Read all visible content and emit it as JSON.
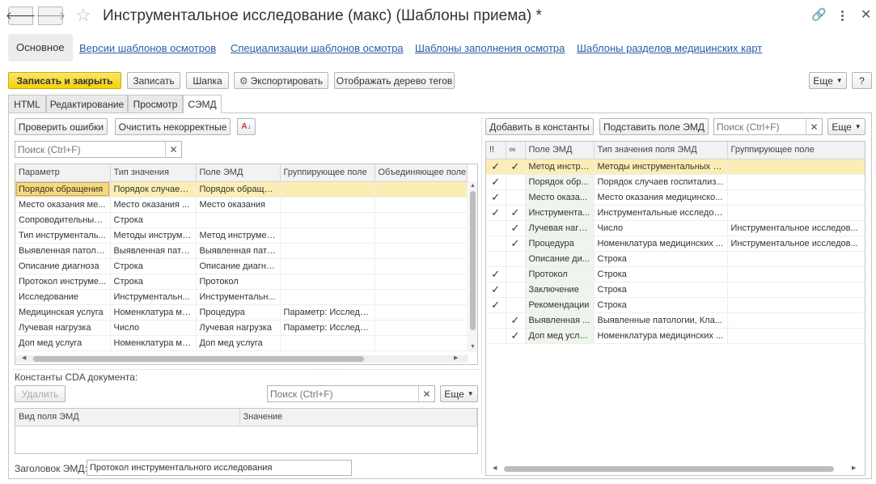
{
  "window": {
    "title": "Инструментальное исследование (макс) (Шаблоны приема) *"
  },
  "nav_tabs": [
    {
      "label": "Основное"
    },
    {
      "label": "Версии шаблонов осмотров"
    },
    {
      "label": "Специализации шаблонов осмотра"
    },
    {
      "label": "Шаблоны заполнения осмотра"
    },
    {
      "label": "Шаблоны разделов медицинских карт"
    }
  ],
  "toolbar": {
    "save_close": "Записать и закрыть",
    "save": "Записать",
    "header": "Шапка",
    "export": "Экспортировать",
    "tags_tree": "Отображать дерево тегов",
    "more": "Еще",
    "help": "?"
  },
  "inner_tabs": [
    {
      "label": "HTML"
    },
    {
      "label": "Редактирование"
    },
    {
      "label": "Просмотр"
    },
    {
      "label": "СЭМД"
    }
  ],
  "left": {
    "check_errors": "Проверить ошибки",
    "clear_incorrect": "Очистить некорректные",
    "search_placeholder": "Поиск (Ctrl+F)",
    "columns": [
      "Параметр",
      "Тип значения",
      "Поле ЭМД",
      "Группирующее поле",
      "Объединяющее поле"
    ],
    "rows": [
      [
        "Порядок обращения",
        "Порядок случаев ...",
        "Порядок обраще...",
        "",
        ""
      ],
      [
        "Место оказания ме...",
        "Место оказания ...",
        "Место оказания",
        "",
        ""
      ],
      [
        "Сопроводительный ...",
        "Строка",
        "",
        "",
        ""
      ],
      [
        "Тип инструменталь...",
        "Методы инструме...",
        "Метод инструмен...",
        "",
        ""
      ],
      [
        "Выявленная патоло...",
        "Выявленная пато...",
        "Выявленная пато...",
        "",
        ""
      ],
      [
        "Описание диагноза",
        "Строка",
        "Описание диагно...",
        "",
        ""
      ],
      [
        "Протокол инструме...",
        "Строка",
        "Протокол",
        "",
        ""
      ],
      [
        "Исследование",
        "Инструментальн...",
        "Инструментальн...",
        "",
        ""
      ],
      [
        "Медицинская услуга",
        "Номенклатура ме...",
        "Процедура",
        "Параметр: Исследо...",
        ""
      ],
      [
        "Лучевая нагрузка",
        "Число",
        "Лучевая нагрузка",
        "Параметр: Исследо...",
        ""
      ],
      [
        "Доп мед услуга",
        "Номенклатура ме...",
        "Доп мед услуга",
        "",
        ""
      ]
    ],
    "constants_label": "Константы CDA документа:",
    "delete": "Удалить",
    "const_search_placeholder": "Поиск (Ctrl+F)",
    "more": "Еще",
    "const_columns": [
      "Вид поля ЭМД",
      "Значение"
    ],
    "emd_header_label": "Заголовок ЭМД:",
    "emd_header_value": "Протокол инструментального исследования"
  },
  "right": {
    "add_constants": "Добавить в константы",
    "substitute_field": "Подставить поле ЭМД",
    "search_placeholder": "Поиск (Ctrl+F)",
    "more": "Еще",
    "columns": [
      "!!",
      "∞",
      "Поле ЭМД",
      "Тип значения поля ЭМД",
      "Группирующее поле"
    ],
    "rows": [
      {
        "c1": true,
        "c2": true,
        "field": "Метод инстру...",
        "type": "Методы инструментальных и...",
        "group": ""
      },
      {
        "c1": true,
        "c2": false,
        "field": "Порядок обр...",
        "type": "Порядок случаев госпитализ...",
        "group": ""
      },
      {
        "c1": true,
        "c2": false,
        "field": "Место оказа...",
        "type": "Место оказания медицинско...",
        "group": ""
      },
      {
        "c1": true,
        "c2": true,
        "field": "Инструмента...",
        "type": "Инструментальные исследов...",
        "group": ""
      },
      {
        "c1": false,
        "c2": true,
        "field": "Лучевая нагр...",
        "type": "Число",
        "group": "Инструментальное исследов..."
      },
      {
        "c1": false,
        "c2": true,
        "field": "Процедура",
        "type": "Номенклатура медицинских ...",
        "group": "Инструментальное исследов..."
      },
      {
        "c1": false,
        "c2": false,
        "field": "Описание ди...",
        "type": "Строка",
        "group": ""
      },
      {
        "c1": true,
        "c2": false,
        "field": "Протокол",
        "type": "Строка",
        "group": ""
      },
      {
        "c1": true,
        "c2": false,
        "field": "Заключение",
        "type": "Строка",
        "group": ""
      },
      {
        "c1": true,
        "c2": false,
        "field": "Рекомендации",
        "type": "Строка",
        "group": ""
      },
      {
        "c1": false,
        "c2": true,
        "field": "Выявленная ...",
        "type": "Выявленные патологии, Кла...",
        "group": ""
      },
      {
        "c1": false,
        "c2": true,
        "field": "Доп мед услу...",
        "type": "Номенклатура медицинских ...",
        "group": ""
      }
    ]
  }
}
